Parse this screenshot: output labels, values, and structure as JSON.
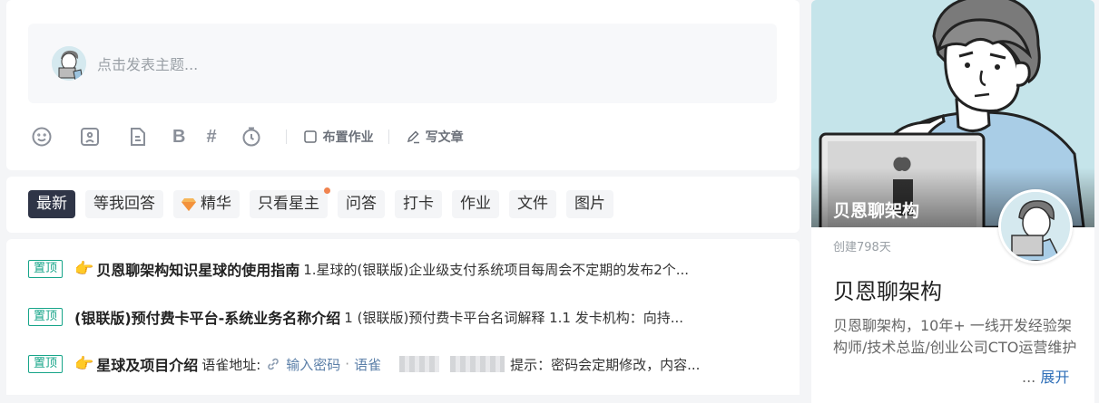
{
  "composer": {
    "placeholder": "点击发表主题...",
    "tools": {
      "bold": "B",
      "hashtag": "#",
      "assign_homework": "布置作业",
      "write_article": "写文章"
    }
  },
  "filters": {
    "active": "最新",
    "items": [
      "最新",
      "等我回答",
      "精华",
      "只看星主",
      "问答",
      "打卡",
      "作业",
      "文件",
      "图片"
    ]
  },
  "pinned": {
    "badge": "置顶",
    "items": [
      {
        "hand": "👉",
        "title": "贝恩聊架构知识星球的使用指南",
        "text": "1.星球的(银联版)企业级支付系统项目每周会不定期的发布2个..."
      },
      {
        "title": "(银联版)预付费卡平台-系统业务名称介绍",
        "text": "1 (银联版)预付费卡平台名词解释 1.1 发卡机构：向持..."
      },
      {
        "hand": "👉",
        "title": "星球及项目介绍",
        "prefix": "语雀地址:",
        "link_text": "输入密码",
        "link_sep": "·",
        "link_text2": "语雀",
        "suffix": "提示：密码会定期修改，内容..."
      }
    ]
  },
  "profile": {
    "banner_title": "贝恩聊架构",
    "created": "创建798天",
    "name": "贝恩聊架构",
    "description": "贝恩聊架构，10年+ 一线开发经验架构师/技术总监/创业公司CTO运营维护",
    "ellipsis": "...",
    "expand": "展开"
  },
  "colors": {
    "active_chip": "#2f3547",
    "pin_badge": "#17a589",
    "link": "#2f6fb8",
    "banner_bg": "#c5e4ea",
    "dot": "#f0834f"
  }
}
